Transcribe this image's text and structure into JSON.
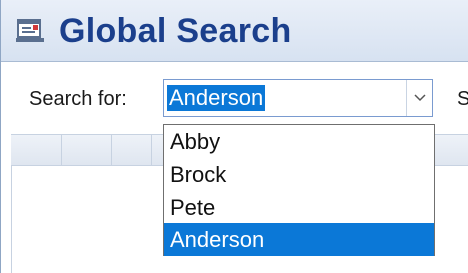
{
  "window": {
    "title": "Global Search",
    "icon": "search-window-icon"
  },
  "search": {
    "label": "Search for:",
    "selected_value": "Anderson",
    "trailing_label_fragment": "S"
  },
  "dropdown": {
    "options": [
      "Abby",
      "Brock",
      "Pete",
      "Anderson"
    ],
    "selected_index": 3
  },
  "colors": {
    "title_text": "#1b3f8c",
    "selection": "#0b78d7"
  }
}
